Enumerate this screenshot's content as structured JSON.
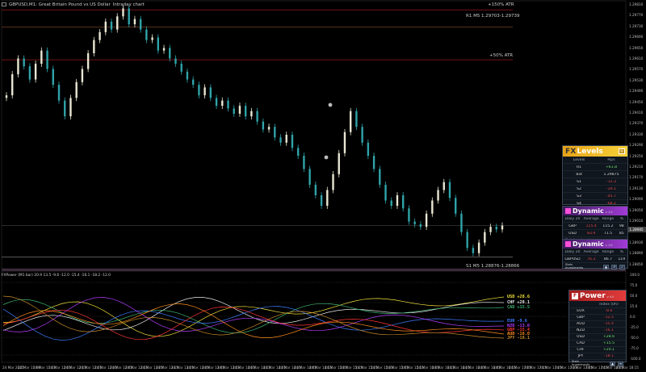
{
  "window": {
    "title": "GBPUSD,M1:  Great Britain Pound vs US Dollar",
    "subtitle": "Intraday chart",
    "indicator_title": "FXPower (M1 bar)  20.9 13.5 -9.6 -12.0 -15.4 -16.1 -18.2 -12.0"
  },
  "main_chart": {
    "levels": [
      {
        "name": "level-r2",
        "label": "+150% ATR",
        "price": 1.29805,
        "color": "#b82020",
        "text_color": "#e84040"
      },
      {
        "name": "level-r1",
        "label": "R1 M5 1.29703-1.29739",
        "price": 1.29739,
        "color": "#8a4a2a",
        "text_color": "#d8d8d8"
      },
      {
        "name": "level-atr",
        "label": "+50% ATR",
        "price": 1.29615,
        "color": "#b82020",
        "text_color": "#e84040"
      },
      {
        "name": "level-s1",
        "label": "S1 M5 1.28876-1.28866",
        "price": 1.28866,
        "color": "#8a8a8a",
        "text_color": "#d8d8d8"
      }
    ],
    "price_axis": [
      "1.29810",
      "1.29770",
      "1.29730",
      "1.29690",
      "1.29650",
      "1.29610",
      "1.29570",
      "1.29530",
      "1.29490",
      "1.29450",
      "1.29410",
      "1.29370",
      "1.29330",
      "1.29290",
      "1.29250",
      "1.29210",
      "1.29170",
      "1.29130",
      "1.29090",
      "1.29050",
      "1.29010",
      "1.28970",
      "1.28930",
      "1.28890",
      "1.28850"
    ],
    "current_price": "1.28985",
    "bid_price": "1.28975",
    "time_axis": [
      "24 Mar 2025",
      "24 Mar 11:46",
      "24 Mar 11:55",
      "24 Mar 12:05",
      "24 Mar 12:15",
      "24 Mar 12:25",
      "24 Mar 12:35",
      "24 Mar 12:45",
      "24 Mar 12:55",
      "24 Mar 13:05",
      "24 Mar 13:15",
      "24 Mar 13:25",
      "24 Mar 13:35",
      "24 Mar 13:45",
      "24 Mar 13:55",
      "24 Mar 14:05",
      "24 Mar 14:15",
      "24 Mar 14:25",
      "24 Mar 14:35",
      "24 Mar 14:45",
      "24 Mar 14:55",
      "24 Mar 15:05",
      "24 Mar 15:15",
      "24 Mar 15:25",
      "24 Mar 15:35",
      "24 Mar 15:45",
      "24 Mar 15:55",
      "24 Mar 16:05",
      "24 Mar 16:15",
      "24 Mar 16:25",
      "24 Mar 16:35",
      "24 Mar 16:45",
      "24 Mar 16:55",
      "24 Mar 17:05",
      "24 Mar 17:15",
      "24 Mar 17:25",
      "24 Mar 17:35",
      "24 Mar 17:45",
      "24 Mar 17:55",
      "24 Mar 18:05",
      "24 Mar 18:15"
    ],
    "indicator_axis": [
      "100.0",
      "75.0",
      "50.0",
      "25.0",
      "0.0",
      "-25.0",
      "-50.0",
      "-75.0",
      "-100.0"
    ]
  },
  "chart_data": {
    "type": "candlestick",
    "ylim": [
      1.2883,
      1.2983
    ],
    "candles_close": [
      1.2948,
      1.2956,
      1.2962,
      1.2959,
      1.2954,
      1.296,
      1.2965,
      1.2958,
      1.2952,
      1.2946,
      1.294,
      1.2947,
      1.2953,
      1.2958,
      1.2964,
      1.2969,
      1.2972,
      1.2976,
      1.2973,
      1.2978,
      1.2981,
      1.2975,
      1.2977,
      1.2973,
      1.2969,
      1.297,
      1.2965,
      1.2966,
      1.2962,
      1.296,
      1.2957,
      1.2954,
      1.2952,
      1.2948,
      1.2951,
      1.2947,
      1.2944,
      1.2946,
      1.2943,
      1.2941,
      1.2944,
      1.294,
      1.2942,
      1.2938,
      1.2935,
      1.2936,
      1.2932,
      1.293,
      1.2933,
      1.2928,
      1.2925,
      1.292,
      1.2914,
      1.291,
      1.2906,
      1.2912,
      1.2918,
      1.2926,
      1.2934,
      1.2942,
      1.2936,
      1.293,
      1.2925,
      1.292,
      1.2914,
      1.2908,
      1.2906,
      1.291,
      1.2905,
      1.29,
      1.2899,
      1.2898,
      1.2903,
      1.2908,
      1.2912,
      1.2915,
      1.2909,
      1.2903,
      1.2896,
      1.289,
      1.2888,
      1.2892,
      1.2896,
      1.2898,
      1.2897,
      1.28985
    ]
  },
  "panels": {
    "levels_panel": {
      "logo_a": "FX",
      "logo_b": "Levels",
      "col_level": "Levels",
      "col_pips": "Pips",
      "rows": [
        {
          "level": "R1",
          "pips": "+61.8",
          "type": "pos"
        },
        {
          "level": "Bid",
          "pips": "1.29875",
          "type": "norm"
        },
        {
          "level": "S1",
          "pips": "-12.3",
          "type": "neg"
        },
        {
          "level": "S2",
          "pips": "-29.1",
          "type": "neg"
        },
        {
          "level": "S3",
          "pips": "-45.7",
          "type": "neg"
        },
        {
          "level": "S4",
          "pips": "-68.2",
          "type": "neg"
        }
      ],
      "brand_line1": "Stein",
      "brand_line2": "Investments"
    },
    "dynamic_panel_1": {
      "logo": "Dynamic",
      "version": "v 1.0",
      "headers": [
        "Daily 20",
        "Average",
        "Range",
        "%"
      ],
      "rows": [
        {
          "name": "GBP",
          "current": "115.4",
          "avg": "115.2",
          "range": "98"
        },
        {
          "name": "USD",
          "current": "83.9",
          "avg": "71.5",
          "range": "85"
        }
      ],
      "brand_line1": "Stein",
      "brand_line2": "Investments"
    },
    "dynamic_panel_2": {
      "logo": "Dynamic",
      "version": "v 1.0",
      "headers": [
        "Daily 20",
        "Average",
        "Range",
        "%"
      ],
      "rows": [
        {
          "name": "GBPUSD",
          "current": "76.3",
          "avg": "86.7",
          "range": "119"
        }
      ],
      "brand_line1": "Stein",
      "brand_line2": "Investments"
    },
    "power_panel": {
      "logo_a": "FX",
      "logo_b": "Power",
      "version": "v 4.0",
      "header": "Index (0h)",
      "rows": [
        {
          "cur": "EUR",
          "val": "-8.6",
          "type": "neg"
        },
        {
          "cur": "GBP",
          "val": "-12.5",
          "type": "neg"
        },
        {
          "cur": "AUD",
          "val": "-15.4",
          "type": "neg"
        },
        {
          "cur": "NZD",
          "val": "-16.1",
          "type": "neg"
        },
        {
          "cur": "USD",
          "val": "+28.6",
          "type": "pos"
        },
        {
          "cur": "CAD",
          "val": "+15.5",
          "type": "pos"
        },
        {
          "cur": "CHF",
          "val": "+20.1",
          "type": "pos"
        },
        {
          "cur": "JPY",
          "val": "-18.1",
          "type": "neg"
        }
      ],
      "brand_line1": "Stein",
      "brand_line2": "Investments"
    }
  },
  "indicator": {
    "labels": [
      {
        "cur": "USD",
        "val": "+28.6",
        "color": "#f2e23a",
        "y": 368
      },
      {
        "cur": "CHF",
        "val": "+20.1",
        "color": "#e9e9e9",
        "y": 375
      },
      {
        "cur": "CAD",
        "val": "+15.5",
        "color": "#3cb371",
        "y": 381
      },
      {
        "cur": "EUR",
        "val": "-9.6",
        "color": "#3d7cff",
        "y": 398
      },
      {
        "cur": "NZD",
        "val": "-13.0",
        "color": "#b43cff",
        "y": 404
      },
      {
        "cur": "GBP",
        "val": "-15.4",
        "color": "#ff3535",
        "y": 409
      },
      {
        "cur": "AUD",
        "val": "-16.0",
        "color": "#ff8c1a",
        "y": 414
      },
      {
        "cur": "JPY",
        "val": "-18.1",
        "color": "#c88a2a",
        "y": 419
      }
    ]
  }
}
